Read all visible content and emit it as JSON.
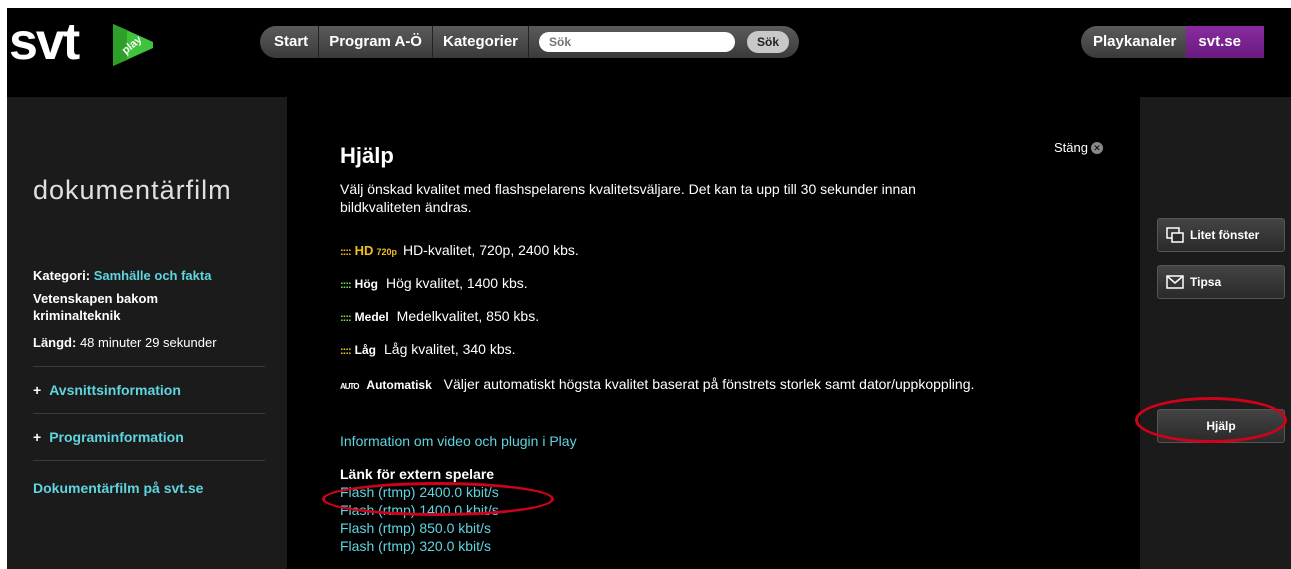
{
  "header": {
    "logo_text": "svt",
    "logo_badge": "play",
    "nav": [
      "Start",
      "Program A-Ö",
      "Kategorier"
    ],
    "search": {
      "placeholder": "Sök",
      "button": "Sök"
    },
    "right_nav": {
      "channels": "Playkanaler",
      "site": "svt.se"
    }
  },
  "sidebar": {
    "title": "dokumentärfilm",
    "category_label": "Kategori:",
    "category_value": "Samhälle och fakta",
    "episode_title": "Vetenskapen bakom kriminalteknik",
    "length_label": "Längd:",
    "length_value": "48 minuter 29 sekunder",
    "expanders": [
      "Avsnittsinformation",
      "Programinformation"
    ],
    "expander_symbol": "+",
    "link": "Dokumentärfilm på svt.se"
  },
  "help": {
    "title": "Hjälp",
    "close_label": "Stäng",
    "intro": "Välj önskad kvalitet med flashspelarens kvalitetsväljare. Det kan ta upp till 30 sekunder innan bildkvaliteten ändras.",
    "qualities": [
      {
        "icon": "::::",
        "label": "HD",
        "sub": "720p",
        "desc": "HD-kvalitet, 720p, 2400 kbs.",
        "color": "#f0c020"
      },
      {
        "icon": "::::",
        "label": "Hög",
        "desc": "Hög kvalitet, 1400 kbs.",
        "color": "#7ed957"
      },
      {
        "icon": "::::",
        "label": "Medel",
        "desc": "Medelkvalitet, 850 kbs.",
        "color": "#7ed957"
      },
      {
        "icon": "::::",
        "label": "Låg",
        "desc": "Låg kvalitet, 340 kbs.",
        "color": "#f0c020"
      }
    ],
    "auto": {
      "icon": "AUTO",
      "label": "Automatisk",
      "desc": "Väljer automatiskt högsta kvalitet baserat på fönstrets storlek samt dator/uppkoppling."
    },
    "info_link": "Information om video och plugin i Play",
    "external_title": "Länk för extern spelare",
    "external_links": [
      "Flash (rtmp) 2400.0 kbit/s",
      "Flash (rtmp) 1400.0 kbit/s",
      "Flash (rtmp) 850.0 kbit/s",
      "Flash (rtmp) 320.0 kbit/s"
    ]
  },
  "side_buttons": {
    "small_window": "Litet fönster",
    "tip": "Tipsa",
    "help": "Hjälp"
  },
  "colors": {
    "accent_link": "#5fd5e0",
    "svtse_purple": "#7a2290",
    "annotation_red": "#d0021b"
  }
}
